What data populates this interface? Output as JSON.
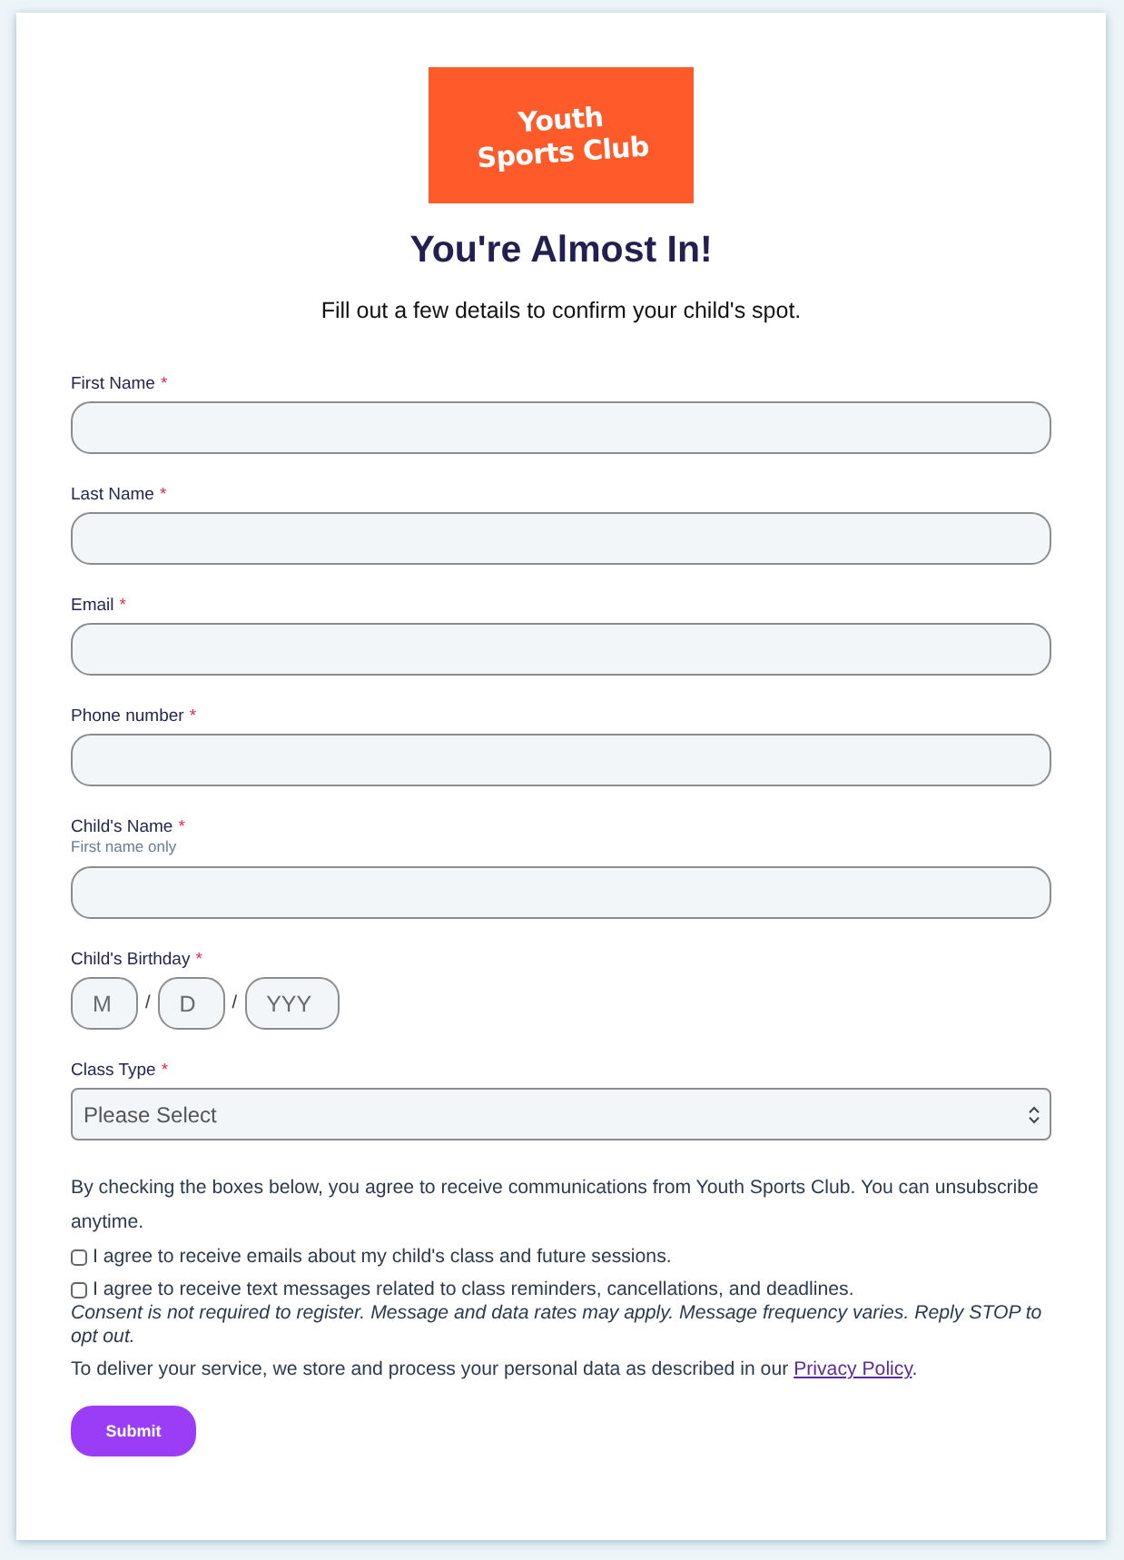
{
  "logo": {
    "lines": [
      "Youth",
      "Sports Club"
    ]
  },
  "title": "You're Almost In!",
  "subtitle": "Fill out a few details to confirm your child's spot.",
  "fields": [
    {
      "kind": "text",
      "label": "First Name",
      "required_mark": "*"
    },
    {
      "kind": "text",
      "label": "Last Name",
      "required_mark": "*"
    },
    {
      "kind": "text",
      "label": "Email",
      "required_mark": "*"
    },
    {
      "kind": "text",
      "label": "Phone number",
      "required_mark": "*"
    },
    {
      "kind": "text",
      "label": "Child's Name",
      "required_mark": "*",
      "hint": "First name only"
    },
    {
      "kind": "date",
      "label": "Child's Birthday",
      "required_mark": "*",
      "parts": [
        {
          "placeholder": "M"
        },
        {
          "placeholder": "D"
        },
        {
          "placeholder": "YYY"
        }
      ],
      "separators": [
        "/",
        "/"
      ]
    },
    {
      "kind": "select",
      "label": "Class Type",
      "required_mark": "*",
      "value": "Please Select"
    }
  ],
  "consent": {
    "intro": "By checking the boxes below, you agree to receive communications from Youth Sports Club. You can unsubscribe anytime.",
    "checkboxes": [
      {
        "label": "I agree to receive emails about my child's class and future sessions.",
        "checked": false
      },
      {
        "label": "I agree to receive text messages related to class reminders, cancellations, and deadlines.",
        "checked": false
      }
    ],
    "note": "Consent is not required to register. Message and data rates may apply. Message frequency varies. Reply STOP to opt out.",
    "privacy": {
      "text": "To deliver your service, we store and process your personal data as described in our ",
      "link": "Privacy Policy",
      "end": "."
    }
  },
  "submit": {
    "label": "Submit"
  }
}
